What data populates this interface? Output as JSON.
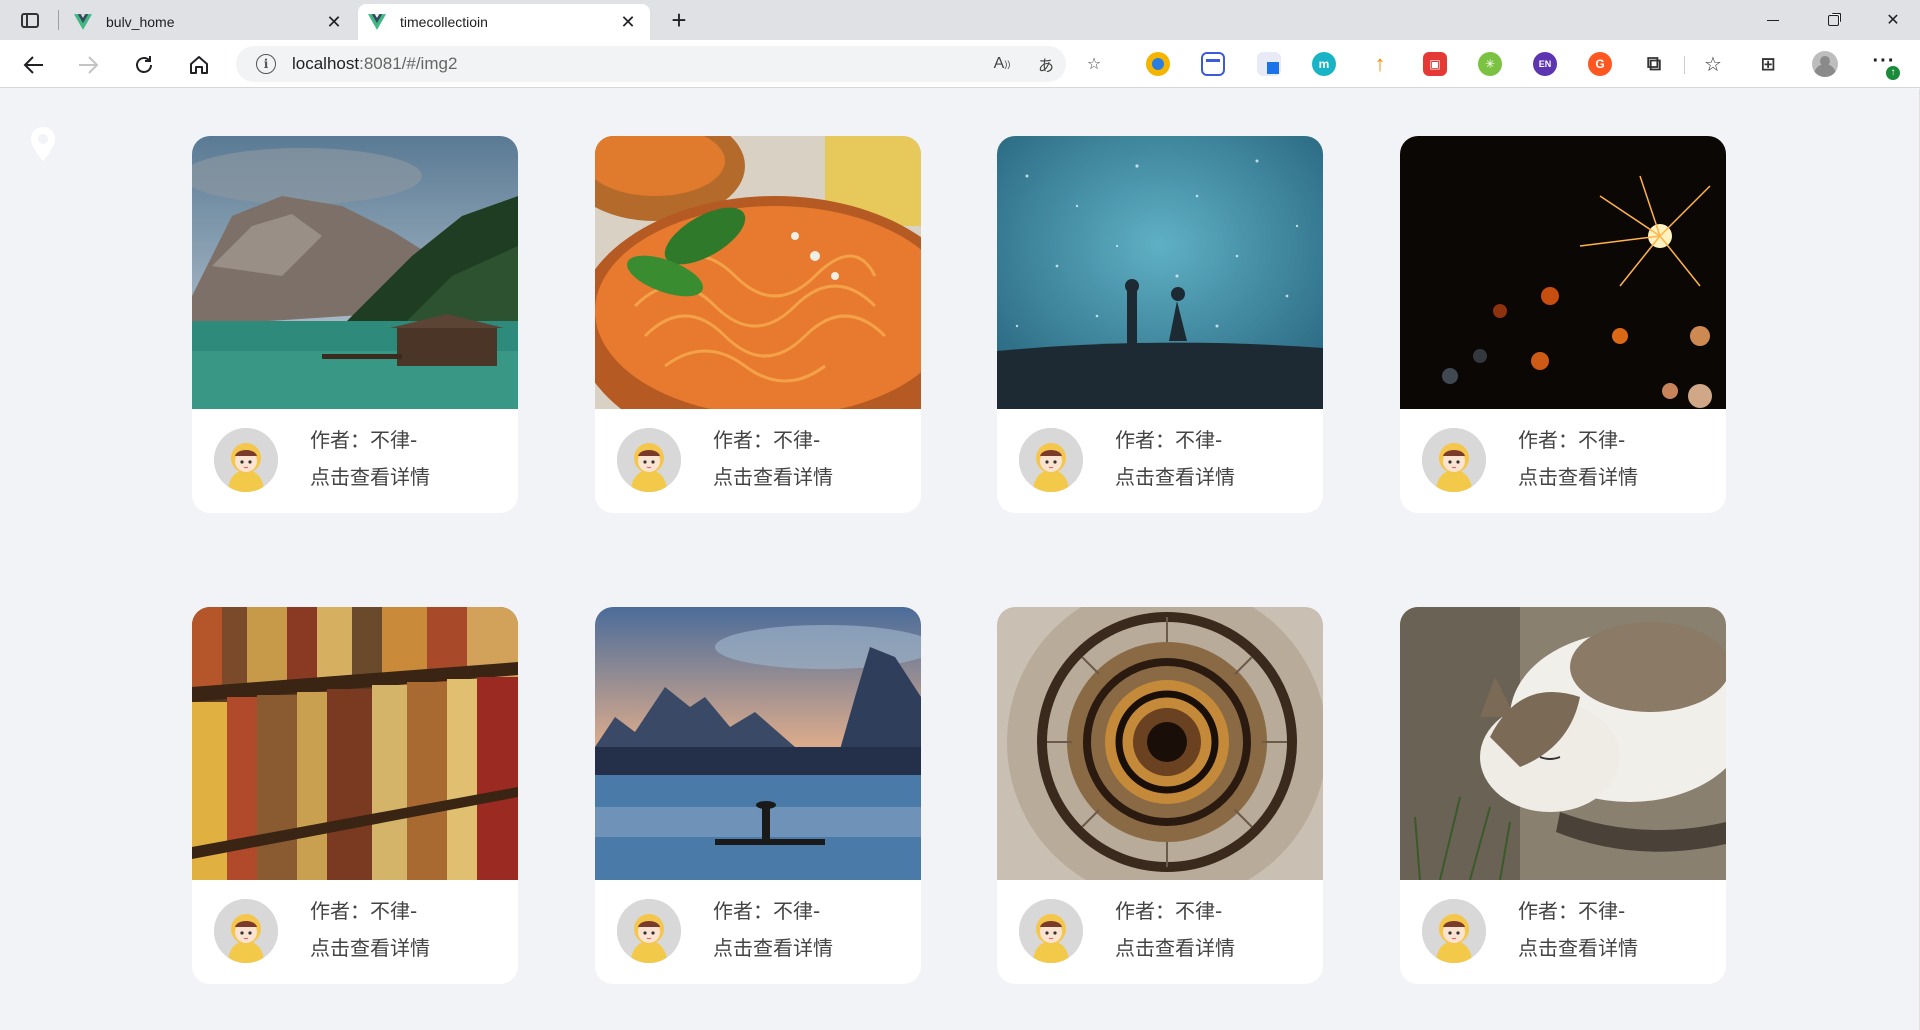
{
  "browser": {
    "tabs": [
      {
        "title": "bulv_home",
        "active": false
      },
      {
        "title": "timecollectioin",
        "active": true
      }
    ],
    "address": {
      "host": "localhost",
      "rest": ":8081/#/img2"
    }
  },
  "cards": [
    {
      "image": "mountain-lake-photo",
      "author": "作者：不律-",
      "detail": "点击查看详情"
    },
    {
      "image": "spaghetti-photo",
      "author": "作者：不律-",
      "detail": "点击查看详情"
    },
    {
      "image": "starry-couple-photo",
      "author": "作者：不律-",
      "detail": "点击查看详情"
    },
    {
      "image": "sparkler-photo",
      "author": "作者：不律-",
      "detail": "点击查看详情"
    },
    {
      "image": "bookshelf-photo",
      "author": "作者：不律-",
      "detail": "点击查看详情"
    },
    {
      "image": "river-fisherman-photo",
      "author": "作者：不律-",
      "detail": "点击查看详情"
    },
    {
      "image": "spiral-staircase-photo",
      "author": "作者：不律-",
      "detail": "点击查看详情"
    },
    {
      "image": "sleeping-cat-photo",
      "author": "作者：不律-",
      "detail": "点击查看详情"
    }
  ],
  "colors": {
    "page_bg": "#f2f3f6",
    "card_bg": "#ffffff",
    "text": "#444444",
    "vue_green": "#41b883",
    "vue_dark": "#35495e"
  }
}
